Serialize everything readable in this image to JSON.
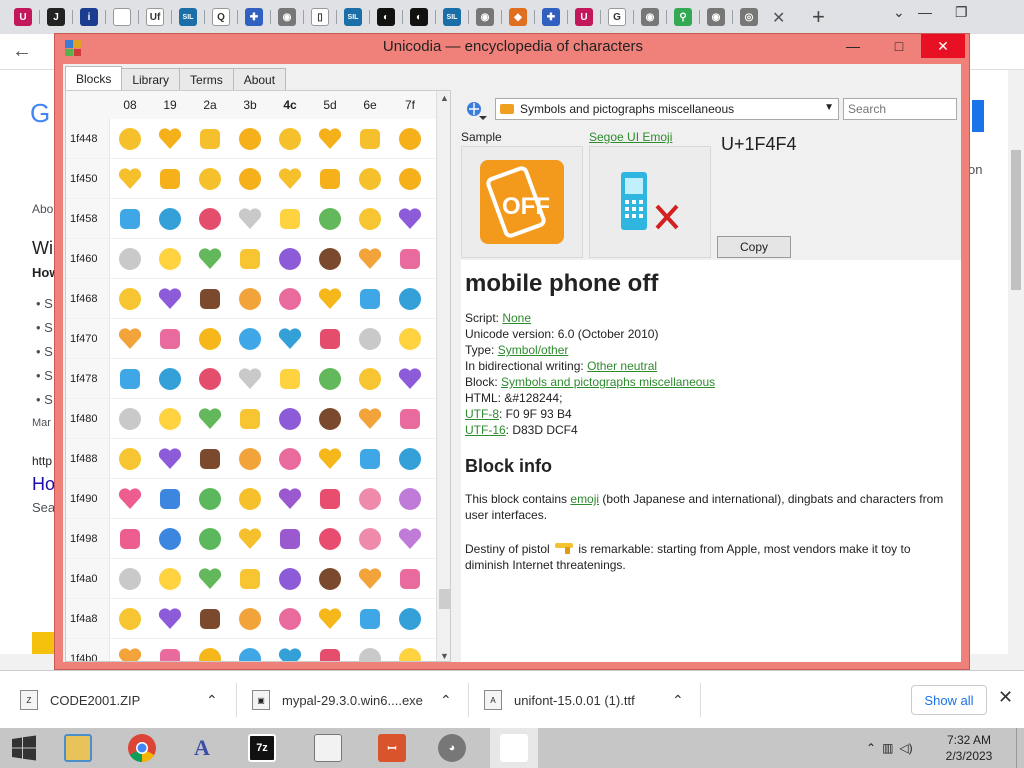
{
  "browser": {
    "tabs": [
      {
        "icon": "unicode-icon",
        "color": "#c2185b",
        "glyph": "U"
      },
      {
        "icon": "j-icon",
        "color": "#222222",
        "glyph": "J"
      },
      {
        "icon": "info-icon",
        "color": "#1a3d8f",
        "glyph": "i"
      },
      {
        "icon": "blank-icon",
        "color": "#ffffff",
        "glyph": ""
      },
      {
        "icon": "uf-icon",
        "color": "#ffffff",
        "glyph": "Uf"
      },
      {
        "icon": "sil-icon",
        "color": "#1b6fa8",
        "glyph": "SIL"
      },
      {
        "icon": "q-icon",
        "color": "#ffffff",
        "glyph": "Q"
      },
      {
        "icon": "unicodia-icon",
        "color": "#3060c0",
        "glyph": "✚"
      },
      {
        "icon": "globe-icon",
        "color": "#777777",
        "glyph": "◉"
      },
      {
        "icon": "doc-icon",
        "color": "#ffffff",
        "glyph": "▯"
      },
      {
        "icon": "sil-icon",
        "color": "#1b6fa8",
        "glyph": "SIL"
      },
      {
        "icon": "dark-icon",
        "color": "#111111",
        "glyph": "◐"
      },
      {
        "icon": "dark-icon",
        "color": "#111111",
        "glyph": "◐"
      },
      {
        "icon": "sil-icon",
        "color": "#1b6fa8",
        "glyph": "SIL"
      },
      {
        "icon": "globe-icon",
        "color": "#777777",
        "glyph": "◉"
      },
      {
        "icon": "diamond-icon",
        "color": "#e07020",
        "glyph": "◆"
      },
      {
        "icon": "unicodia-icon",
        "color": "#3060c0",
        "glyph": "✚"
      },
      {
        "icon": "unicode-icon",
        "color": "#c2185b",
        "glyph": "U"
      },
      {
        "icon": "google-icon",
        "color": "#ffffff",
        "glyph": "G"
      },
      {
        "icon": "globe-icon",
        "color": "#777777",
        "glyph": "◉"
      },
      {
        "icon": "maps-icon",
        "color": "#34a853",
        "glyph": "⚲"
      },
      {
        "icon": "globe-icon",
        "color": "#777777",
        "glyph": "◉"
      },
      {
        "icon": "chrome-icon",
        "color": "#777777",
        "glyph": "◎"
      }
    ],
    "close_glyph": "✕",
    "new_tab_glyph": "+",
    "chevron_glyph": "⌄",
    "minimize_glyph": "—",
    "maximize_glyph": "❐",
    "back_glyph": "←"
  },
  "bg_page": {
    "logo": "G",
    "about": "Abo",
    "result1": "Wi",
    "how": "How",
    "bullets": [
      "S",
      "S",
      "S",
      "S",
      "S"
    ],
    "mar": "Mar",
    "http": "http",
    "ho": "Ho",
    "sea": "Sea",
    "on": "on"
  },
  "app": {
    "title": "Unicodia — encyclopedia of characters",
    "minimize": "—",
    "maximize": "□",
    "close": "✕",
    "tabs": [
      "Blocks",
      "Library",
      "Terms",
      "About"
    ],
    "columns": [
      "08",
      "19",
      "2a",
      "3b",
      "4c",
      "5d",
      "6e",
      "7f"
    ],
    "bold_column": "4c",
    "rows": [
      "1f448",
      "1f450",
      "1f458",
      "1f460",
      "1f468",
      "1f470",
      "1f478",
      "1f480",
      "1f488",
      "1f490",
      "1f498",
      "1f4a0",
      "1f4a8",
      "1f4b0"
    ],
    "block_name": "Symbols and pictographs miscellaneous",
    "search_placeholder": "Search",
    "sample_label": "Sample",
    "font_label": "Segoe UI Emoji",
    "codepoint": "U+1F4F4",
    "copy_label": "Copy",
    "char_name": "mobile phone off",
    "props": {
      "script_label": "Script: ",
      "script_value": "None",
      "version_label": "Unicode version: ",
      "version_value": "6.0 (October 2010)",
      "type_label": "Type: ",
      "type_value": "Symbol/other",
      "bidi_label": "In bidirectional writing: ",
      "bidi_value": "Other neutral",
      "block_label": "Block: ",
      "block_value": "Symbols and pictographs miscellaneous",
      "html_label": "HTML: ",
      "html_value": "&#128244;",
      "utf8_label": "UTF-8",
      "utf8_value": ": F0 9F 93 B4",
      "utf16_label": "UTF-16",
      "utf16_value": ": D83D DCF4"
    },
    "block_info_heading": "Block info",
    "para1_a": "This block contains ",
    "para1_link": "emoji",
    "para1_b": " (both Japanese and international), dingbats and characters from user interfaces.",
    "para2_a": "Destiny of pistol ",
    "para2_b": " is remarkable: starting from Apple, most vendors make it toy to diminish Internet threatenings."
  },
  "downloads": [
    {
      "name": "CODE2001.ZIP",
      "icon": "zip-file-icon"
    },
    {
      "name": "mypal-29.3.0.win6....exe",
      "icon": "exe-file-icon"
    },
    {
      "name": "unifont-15.0.01 (1).ttf",
      "icon": "font-file-icon"
    }
  ],
  "show_all": "Show all",
  "shelf_close": "✕",
  "taskbar": {
    "apps": [
      "start",
      "file-explorer",
      "chrome",
      "pen-app",
      "7zip",
      "notepad",
      "office",
      "raccoon",
      "unicodia"
    ],
    "clock_time": "7:32 AM",
    "clock_date": "2/3/2023"
  },
  "colors": {
    "window_frame": "#f0807a",
    "link": "#2e8b2e",
    "sample_orange": "#f39a1c",
    "phone_cyan": "#2fb6e0",
    "cross_red": "#d32020"
  }
}
